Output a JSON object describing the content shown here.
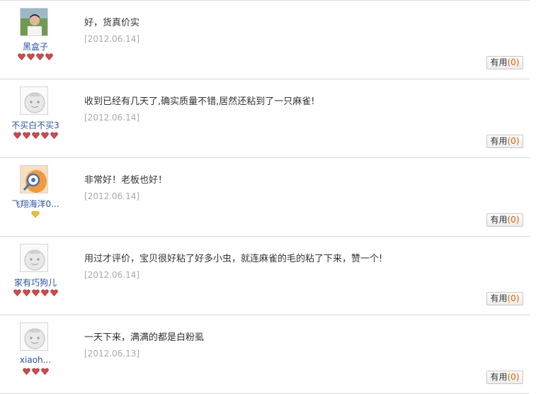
{
  "reviews": [
    {
      "user": "黑盒子",
      "avatar": "photo-avatar-icon",
      "rank_icons": [
        "heart-rank-icon",
        "heart-rank-icon",
        "heart-rank-icon",
        "heart-rank-icon"
      ],
      "content": "好，货真价实",
      "date": "[2012.06.14]",
      "useful_label": "有用",
      "useful_count": "(0)"
    },
    {
      "user": "不买白不买3",
      "avatar": "default-avatar-icon",
      "rank_icons": [
        "heart-rank-icon",
        "heart-rank-icon",
        "heart-rank-icon",
        "heart-rank-icon",
        "heart-rank-icon"
      ],
      "content": "收到已经有几天了,确实质量不错,居然还粘到了一只麻雀!",
      "date": "[2012.06.14]",
      "useful_label": "有用",
      "useful_count": "(0)"
    },
    {
      "user": "飞翔海洋0...",
      "avatar": "cartoon-avatar-icon",
      "rank_icons": [
        "diamond-rank-icon"
      ],
      "content": "非常好！老板也好！",
      "date": "[2012.06.14]",
      "useful_label": "有用",
      "useful_count": "(0)"
    },
    {
      "user": "家有巧狗儿",
      "avatar": "default-avatar-icon",
      "rank_icons": [
        "heart-rank-icon",
        "heart-rank-icon",
        "heart-rank-icon",
        "heart-rank-icon",
        "heart-rank-icon"
      ],
      "content": "用过才评价，宝贝很好粘了好多小虫，就连麻雀的毛的粘了下来，赞一个!",
      "date": "[2012.06.14]",
      "useful_label": "有用",
      "useful_count": "(0)"
    },
    {
      "user": "xiaoh...",
      "avatar": "default-avatar-icon",
      "rank_icons": [
        "heart-rank-icon",
        "heart-rank-icon",
        "heart-rank-icon"
      ],
      "content": "一天下来，满满的都是白粉虱",
      "date": "[2012.06.13]",
      "useful_label": "有用",
      "useful_count": "(0)"
    }
  ],
  "colors": {
    "username": "#2953a6",
    "date": "#a9a9a9",
    "count": "#e55a00",
    "heart": "#d94747",
    "diamond": "#f0c419"
  }
}
